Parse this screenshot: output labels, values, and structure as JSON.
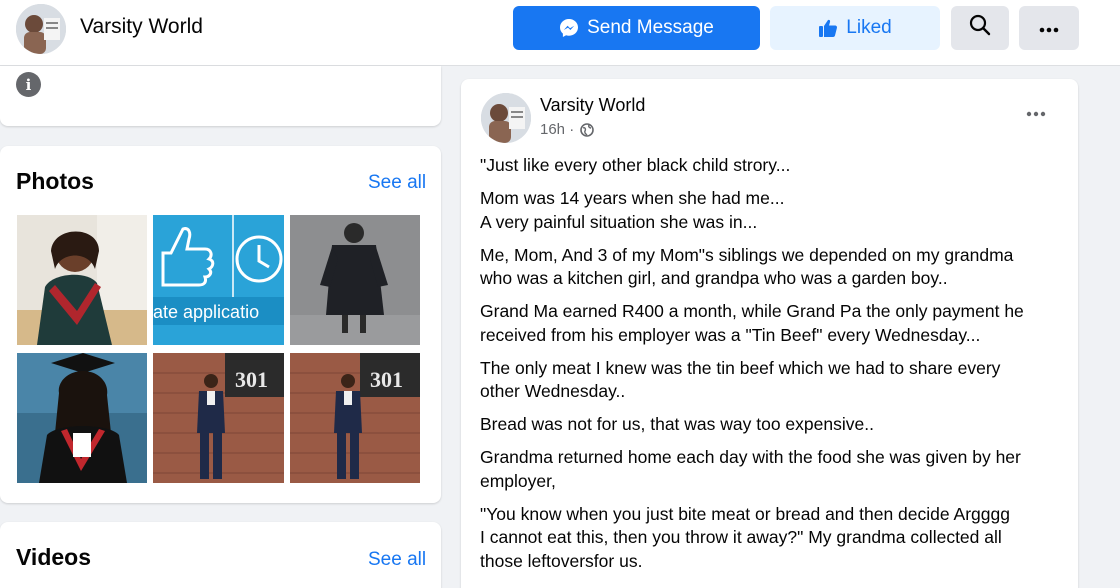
{
  "header": {
    "page_name": "Varsity World",
    "send_label": "Send Message",
    "liked_label": "Liked",
    "icons": {
      "send": "messenger-icon",
      "liked": "thumbs-up-icon",
      "search": "search-icon",
      "more": "more-horizontal-icon"
    }
  },
  "intro": {
    "icon": "info-icon"
  },
  "photos": {
    "title": "Photos",
    "see_all": "See all",
    "items": [
      {
        "name": "graduate-woman-photo"
      },
      {
        "name": "update-application-graphic",
        "text": "ate applicatio"
      },
      {
        "name": "graduate-gown-photo"
      },
      {
        "name": "graduate-cap-photo"
      },
      {
        "name": "woman-suit-301-photo",
        "text": "301"
      },
      {
        "name": "woman-suit-301-photo-2",
        "text": "301"
      }
    ]
  },
  "videos": {
    "title": "Videos",
    "see_all": "See all"
  },
  "post": {
    "author": "Varsity World",
    "time": "16h ·",
    "paragraphs": [
      "\"Just like every other black child  strory...",
      "Mom was 14 years when she had me...\nA very painful situation she was in...",
      "Me, Mom, And 3 of my Mom\"s siblings we depended on my grandma\nwho was a kitchen girl, and grandpa who was a garden boy..",
      "Grand Ma earned R400 a month, while Grand Pa the only payment he\nreceived from his employer was a \"Tin Beef\" every Wednesday...",
      "The only meat I knew was the tin beef which we had to share every\nother Wednesday..",
      "Bread was not for us, that was way too expensive..",
      "Grandma returned home  each day with the food she was given by her\nemployer,",
      " \"You know when you just bite meat or bread and then decide Argggg\nI cannot eat this, then you throw it away?\" My grandma collected all\nthose leftoversfor us."
    ]
  },
  "colors": {
    "brand_blue": "#1877f2",
    "light_blue": "#e7f3ff",
    "grey_button": "#e4e6eb",
    "page_bg": "#f0f2f5",
    "secondary_text": "#65676b"
  }
}
